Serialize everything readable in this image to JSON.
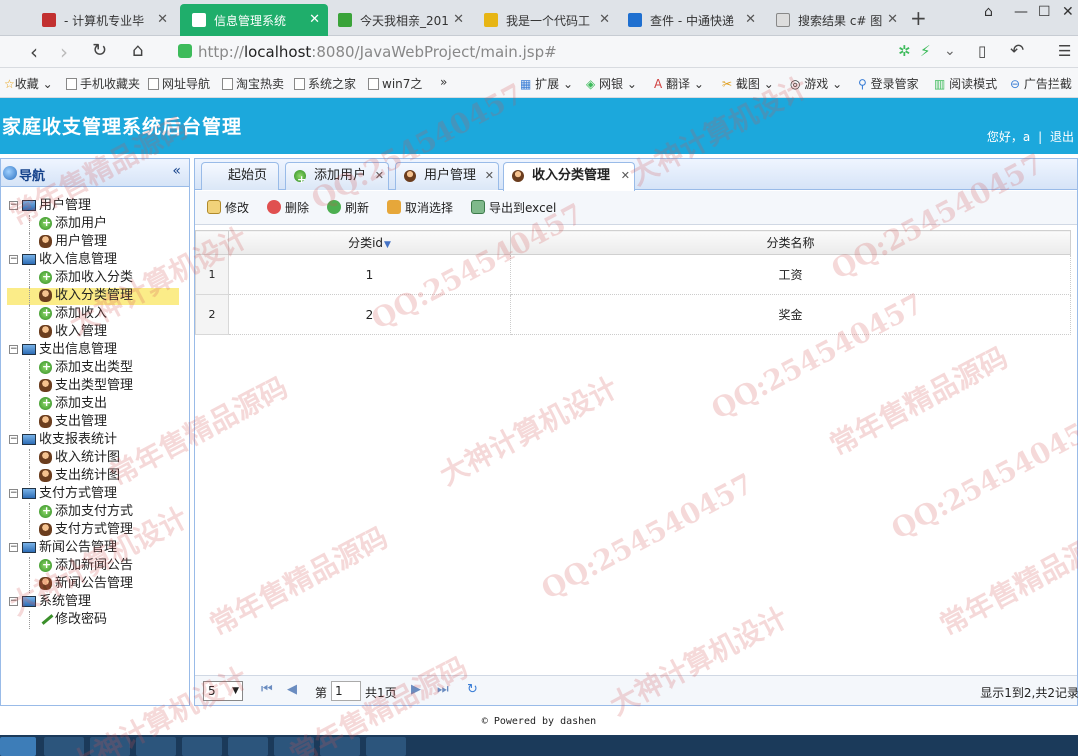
{
  "browser": {
    "tabs": [
      {
        "label": "- 计算机专业毕",
        "color": "#c23030"
      },
      {
        "label": "信息管理系统",
        "color": "#ffffff",
        "active": true
      },
      {
        "label": "今天我相亲_201",
        "color": "#3aa33a"
      },
      {
        "label": "我是一个代码工",
        "color": "#e7b514"
      },
      {
        "label": "查件 - 中通快递",
        "color": "#1e6fd0"
      },
      {
        "label": "搜索结果 c# 图",
        "color": "#888888"
      }
    ],
    "url_prefix": "http://",
    "url_host": "localhost",
    "url_rest": ":8080/JavaWebProject/main.jsp#",
    "bookmarks_left": [
      "收藏",
      "手机收藏夹",
      "网址导航",
      "淘宝热卖",
      "系统之家",
      "win7之"
    ],
    "more": "»",
    "bookmarks_right": [
      "扩展",
      "网银",
      "翻译",
      "截图",
      "游戏",
      "登录管家",
      "阅读模式",
      "广告拦截"
    ]
  },
  "app": {
    "title": "家庭收支管理系统后台管理",
    "greeting": "您好，a",
    "logout": "退出"
  },
  "sidebar": {
    "title": "导航",
    "collapse": "«",
    "groups": [
      {
        "label": "用户管理",
        "items": [
          "添加用户",
          "用户管理"
        ]
      },
      {
        "label": "收入信息管理",
        "items": [
          "添加收入分类",
          "收入分类管理",
          "添加收入",
          "收入管理"
        ]
      },
      {
        "label": "支出信息管理",
        "items": [
          "添加支出类型",
          "支出类型管理",
          "添加支出",
          "支出管理"
        ]
      },
      {
        "label": "收支报表统计",
        "items": [
          "收入统计图",
          "支出统计图"
        ]
      },
      {
        "label": "支付方式管理",
        "items": [
          "添加支付方式",
          "支付方式管理"
        ]
      },
      {
        "label": "新闻公告管理",
        "items": [
          "添加新闻公告",
          "新闻公告管理"
        ]
      },
      {
        "label": "系统管理",
        "items": [
          "修改密码"
        ]
      }
    ]
  },
  "tabs": [
    "起始页",
    "添加用户",
    "用户管理",
    "收入分类管理"
  ],
  "toolbar": {
    "edit": "修改",
    "delete": "删除",
    "refresh": "刷新",
    "cancel": "取消选择",
    "export": "导出到excel"
  },
  "grid": {
    "columns": [
      "分类id",
      "分类名称"
    ],
    "rows": [
      {
        "num": "1",
        "id": "1",
        "name": "工资"
      },
      {
        "num": "2",
        "id": "2",
        "name": "奖金"
      }
    ]
  },
  "pager": {
    "page_size": "5",
    "page_label": "第",
    "page_value": "1",
    "total_pages": "共1页",
    "info": "显示1到2,共2记录"
  },
  "footer": "© Powered by dashen",
  "watermarks": [
    "QQ:254540457",
    "常年售精品源码",
    "大神计算机设计"
  ]
}
